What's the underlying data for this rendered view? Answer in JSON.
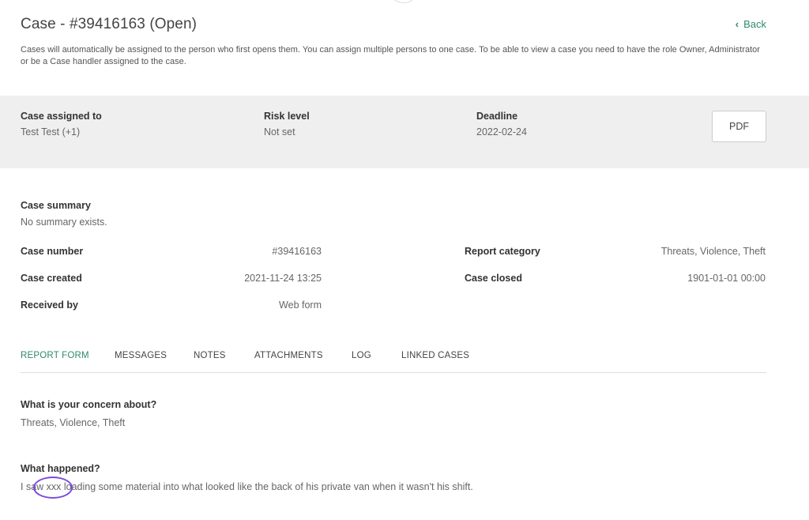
{
  "header": {
    "title": "Case - #39416163 (Open)",
    "back_label": "Back",
    "description": "Cases will automatically be assigned to the person who first opens them. You can assign multiple persons to one case. To be able to view a case you need to have the role Owner, Administrator or be a Case handler assigned to the case."
  },
  "overview": {
    "assigned_label": "Case assigned to",
    "assigned_value": "Test Test (+1)",
    "risk_label": "Risk level",
    "risk_value": "Not set",
    "deadline_label": "Deadline",
    "deadline_value": "2022-02-24",
    "pdf_label": "PDF"
  },
  "summary": {
    "label": "Case summary",
    "value": "No summary exists."
  },
  "details": {
    "case_number_label": "Case number",
    "case_number_value": "#39416163",
    "case_created_label": "Case created",
    "case_created_value": "2021-11-24 13:25",
    "received_by_label": "Received by",
    "received_by_value": "Web form",
    "report_category_label": "Report category",
    "report_category_value": "Threats, Violence, Theft",
    "case_closed_label": "Case closed",
    "case_closed_value": "1901-01-01 00:00"
  },
  "tabs": [
    {
      "label": "REPORT FORM",
      "active": true
    },
    {
      "label": "MESSAGES",
      "active": false
    },
    {
      "label": "NOTES",
      "active": false
    },
    {
      "label": "ATTACHMENTS",
      "active": false
    },
    {
      "label": "LOG",
      "active": false
    },
    {
      "label": "LINKED CASES",
      "active": false
    }
  ],
  "report": {
    "q1_label": "What is your concern about?",
    "q1_value": "Threats, Violence, Theft",
    "q2_label": "What happened?",
    "q2_value": "I saw xxx loading some material into what looked like the back of his private van when it wasn't his shift."
  },
  "colors": {
    "accent": "#2e8b6e",
    "band_bg": "#efefef",
    "highlight": "#7b4be0"
  }
}
